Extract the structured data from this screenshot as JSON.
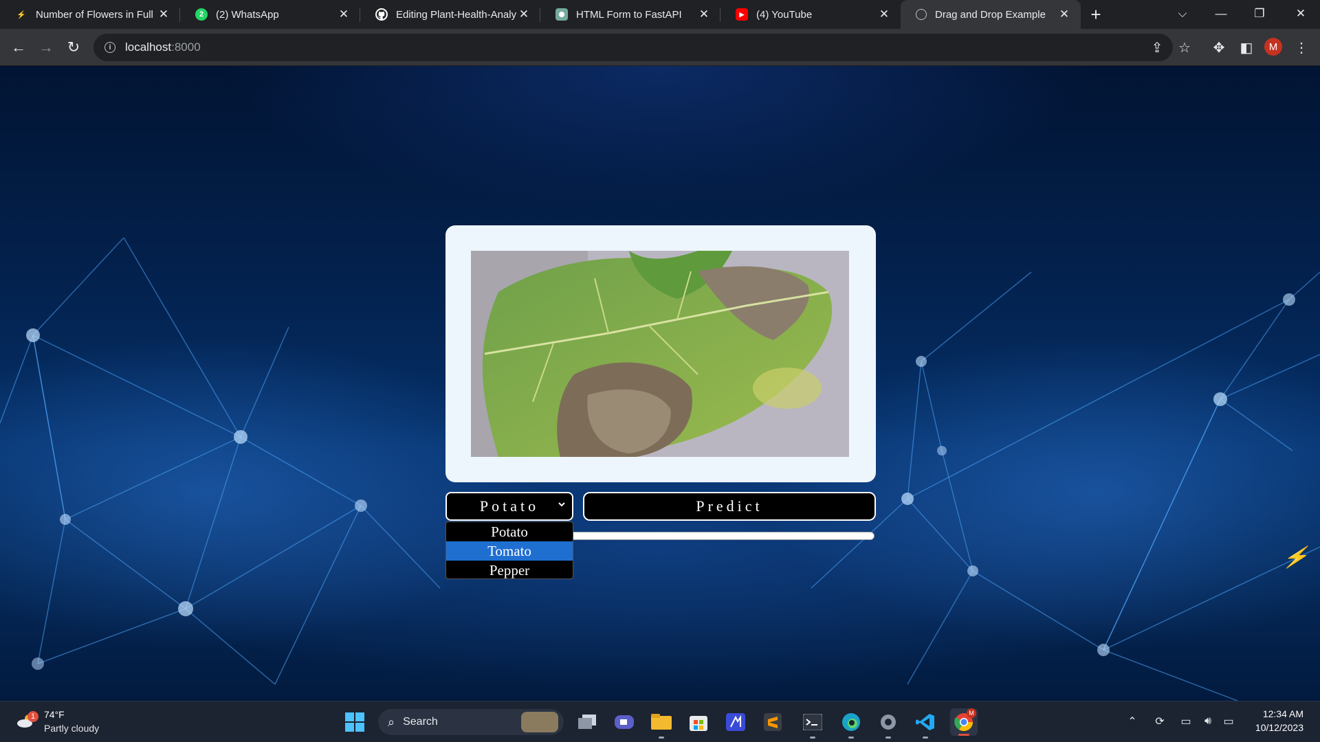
{
  "browser": {
    "tabs": [
      {
        "title": "Number of Flowers in Full I",
        "favicon": "lightning-favicon",
        "active": false
      },
      {
        "title": "(2) WhatsApp",
        "favicon": "whatsapp-favicon",
        "active": false
      },
      {
        "title": "Editing Plant-Health-Analy",
        "favicon": "github-favicon",
        "active": false
      },
      {
        "title": "HTML Form to FastAPI",
        "favicon": "chatgpt-favicon",
        "active": false
      },
      {
        "title": "(4) YouTube",
        "favicon": "youtube-favicon",
        "active": false
      },
      {
        "title": "Drag and Drop Example",
        "favicon": "globe-favicon",
        "active": true
      }
    ],
    "whatsapp_badge": "2",
    "address": {
      "host": "localhost",
      "port": ":8000"
    },
    "profile_initial": "M"
  },
  "page": {
    "select": {
      "selected": "Potato",
      "options": [
        "Potato",
        "Tomato",
        "Pepper"
      ],
      "highlighted": "Tomato"
    },
    "predict_label": "Predict",
    "colors": {
      "card": "#eef6fd",
      "highlight": "#1f6fd1",
      "button_bg": "#000000"
    }
  },
  "taskbar": {
    "weather": {
      "badge": "1",
      "temp": "74°F",
      "condition": "Partly cloudy"
    },
    "search_label": "Search",
    "clock": {
      "time": "12:34 AM",
      "date": "10/12/2023"
    },
    "chrome_badge": "M"
  }
}
